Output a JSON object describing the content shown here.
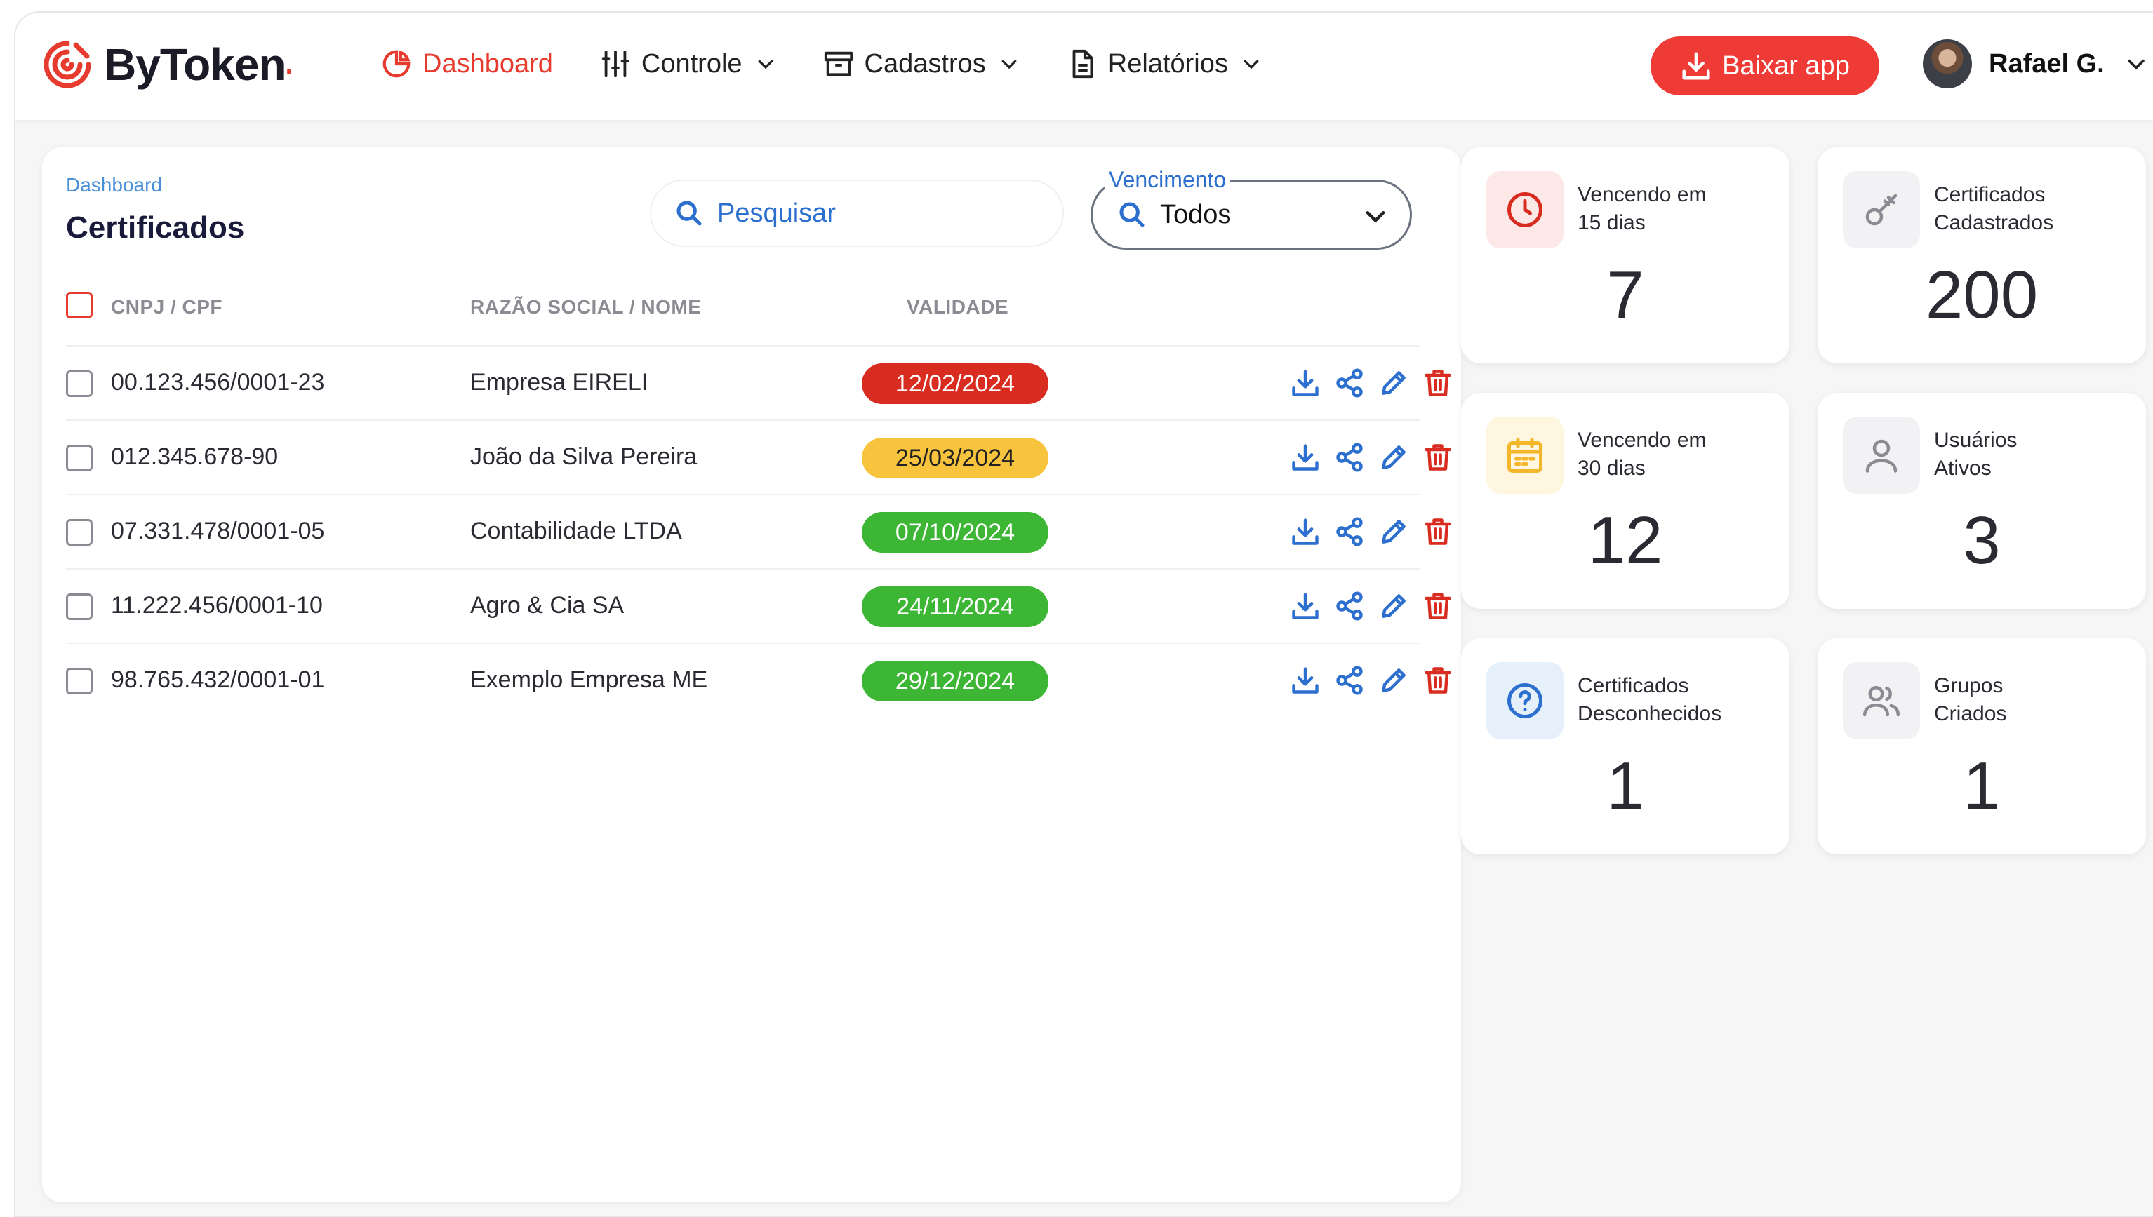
{
  "brand": {
    "name": "ByToken",
    "dot": ".",
    "accent": "#e63b2e"
  },
  "nav": {
    "dashboard": "Dashboard",
    "controle": "Controle",
    "cadastros": "Cadastros",
    "relatorios": "Relatórios"
  },
  "header": {
    "download_button": "Baixar app",
    "user_name": "Rafael G."
  },
  "main": {
    "breadcrumb": "Dashboard",
    "title": "Certificados",
    "search_placeholder": "Pesquisar",
    "filter_label": "Vencimento",
    "filter_value": "Todos",
    "columns": [
      "CNPJ / CPF",
      "RAZÃO SOCIAL / NOME",
      "VALIDADE"
    ],
    "rows": [
      {
        "doc": "00.123.456/0001-23",
        "name": "Empresa EIRELI",
        "validity": "12/02/2024",
        "status_color": "#d82c20"
      },
      {
        "doc": "012.345.678-90",
        "name": "João da Silva Pereira",
        "validity": "25/03/2024",
        "status_color": "#f8c33d"
      },
      {
        "doc": "07.331.478/0001-05",
        "name": "Contabilidade LTDA",
        "validity": "07/10/2024",
        "status_color": "#3cb634"
      },
      {
        "doc": "11.222.456/0001-10",
        "name": "Agro & Cia SA",
        "validity": "24/11/2024",
        "status_color": "#3cb634"
      },
      {
        "doc": "98.765.432/0001-01",
        "name": "Exemplo Empresa ME",
        "validity": "29/12/2024",
        "status_color": "#3cb634"
      }
    ]
  },
  "stats": [
    {
      "label_1": "Vencendo em",
      "label_2": "15 dias",
      "value": "7",
      "icon": "clock-icon"
    },
    {
      "label_1": "Certificados",
      "label_2": "Cadastrados",
      "value": "200",
      "icon": "key-icon"
    },
    {
      "label_1": "Vencendo em",
      "label_2": "30 dias",
      "value": "12",
      "icon": "calendar-icon"
    },
    {
      "label_1": "Usuários",
      "label_2": "Ativos",
      "value": "3",
      "icon": "user-icon"
    },
    {
      "label_1": "Certificados",
      "label_2": "Desconhecidos",
      "value": "1",
      "icon": "question-icon"
    },
    {
      "label_1": "Grupos",
      "label_2": "Criados",
      "value": "1",
      "icon": "users-icon"
    }
  ]
}
